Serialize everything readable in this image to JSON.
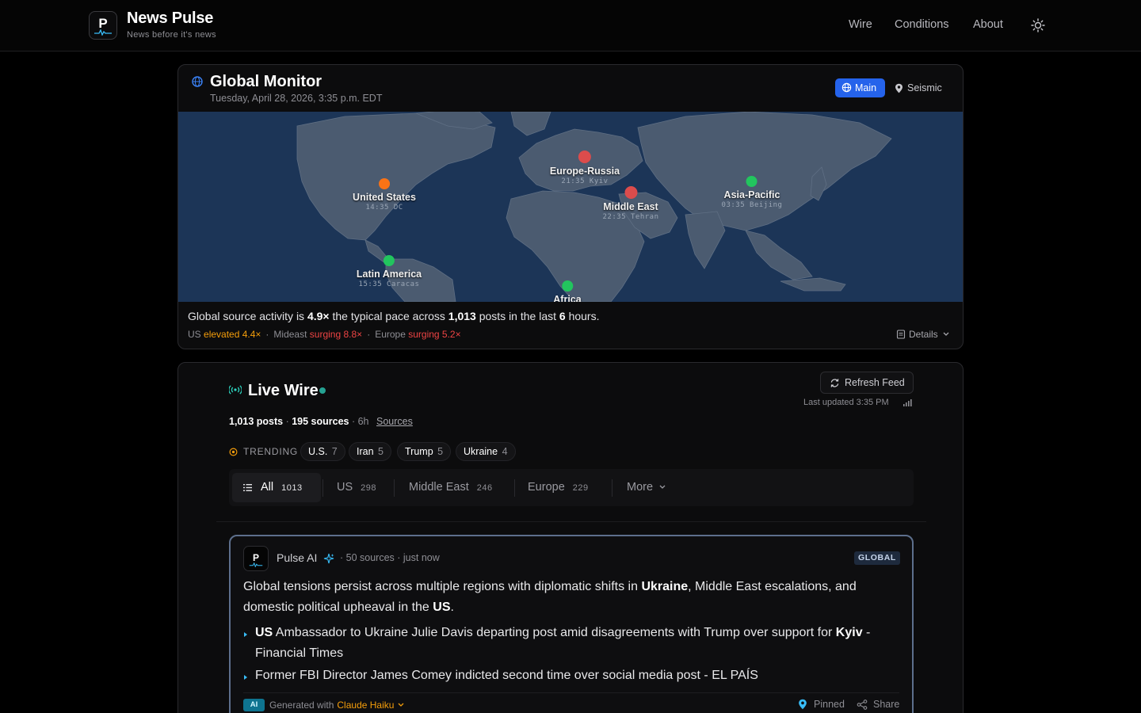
{
  "header": {
    "brand_letter": "P",
    "brand_title": "News Pulse",
    "brand_subtitle": "News before it's news",
    "nav": [
      "Wire",
      "Conditions",
      "About"
    ],
    "theme_icon": "sun-icon"
  },
  "monitor": {
    "title": "Global Monitor",
    "date": "Tuesday, April 28, 2026, 3:35 p.m. EDT",
    "view_main": "Main",
    "view_seismic": "Seismic",
    "regions": [
      {
        "name": "United States",
        "time": "14:35 DC",
        "status": "elevated",
        "color": "#f97316"
      },
      {
        "name": "Europe-Russia",
        "time": "21:35 Kyiv",
        "status": "surging",
        "color": "#dc4c4c"
      },
      {
        "name": "Middle East",
        "time": "22:35 Tehran",
        "status": "surging",
        "color": "#dc4c4c"
      },
      {
        "name": "Asia-Pacific",
        "time": "03:35 Beijing",
        "status": "normal",
        "color": "#22c55e"
      },
      {
        "name": "Latin America",
        "time": "15:35 Caracas",
        "status": "normal",
        "color": "#22c55e"
      },
      {
        "name": "Africa",
        "time": "",
        "status": "normal",
        "color": "#22c55e"
      }
    ],
    "activity": {
      "prefix": "Global source activity is",
      "multiplier": "4.9×",
      "mid": "the typical pace across",
      "posts": "1,013",
      "mid2": "posts in the last",
      "hours": "6",
      "suffix": "hours."
    },
    "region_rates": [
      {
        "label": "US",
        "state": "elevated 4.4×"
      },
      {
        "label": "Mideast",
        "state": "surging 8.8×"
      },
      {
        "label": "Europe",
        "state": "surging 5.2×"
      }
    ],
    "details_label": "Details"
  },
  "wire": {
    "title": "Live Wire",
    "refresh_label": "Refresh Feed",
    "last_updated": "Last updated 3:35 PM",
    "stats": {
      "posts": "1,013 posts",
      "sources": "195 sources",
      "window": "6h",
      "sources_link": "Sources"
    },
    "trending_label": "TRENDING",
    "trending": [
      {
        "label": "U.S.",
        "count": "7"
      },
      {
        "label": "Iran",
        "count": "5"
      },
      {
        "label": "Trump",
        "count": "5"
      },
      {
        "label": "Ukraine",
        "count": "4"
      }
    ],
    "tabs": [
      {
        "label": "All",
        "count": "1013"
      },
      {
        "label": "US",
        "count": "298"
      },
      {
        "label": "Middle East",
        "count": "246"
      },
      {
        "label": "Europe",
        "count": "229"
      },
      {
        "label": "More",
        "count": ""
      }
    ]
  },
  "summary": {
    "author": "Pulse AI",
    "meta": "· 50 sources · just now",
    "badge": "GLOBAL",
    "intro_a": "Global tensions persist across multiple regions with diplomatic shifts in",
    "intro_b": "Ukraine",
    "intro_c": ", Middle East escalations, and domestic political upheaval in the",
    "intro_d": "US",
    "intro_e": ".",
    "bullet1_a": "US",
    "bullet1_b": "Ambassador to Ukraine Julie Davis departing post amid disagreements with Trump over support for",
    "bullet1_c": "Kyiv",
    "bullet1_d": "- Financial Times",
    "bullet2": "Former FBI Director James Comey indicted second time over social media post - EL PAÍS",
    "ai_tag": "AI",
    "generated_with": "Generated with",
    "model": "Claude Haiku",
    "pinned": "Pinned",
    "share": "Share"
  }
}
